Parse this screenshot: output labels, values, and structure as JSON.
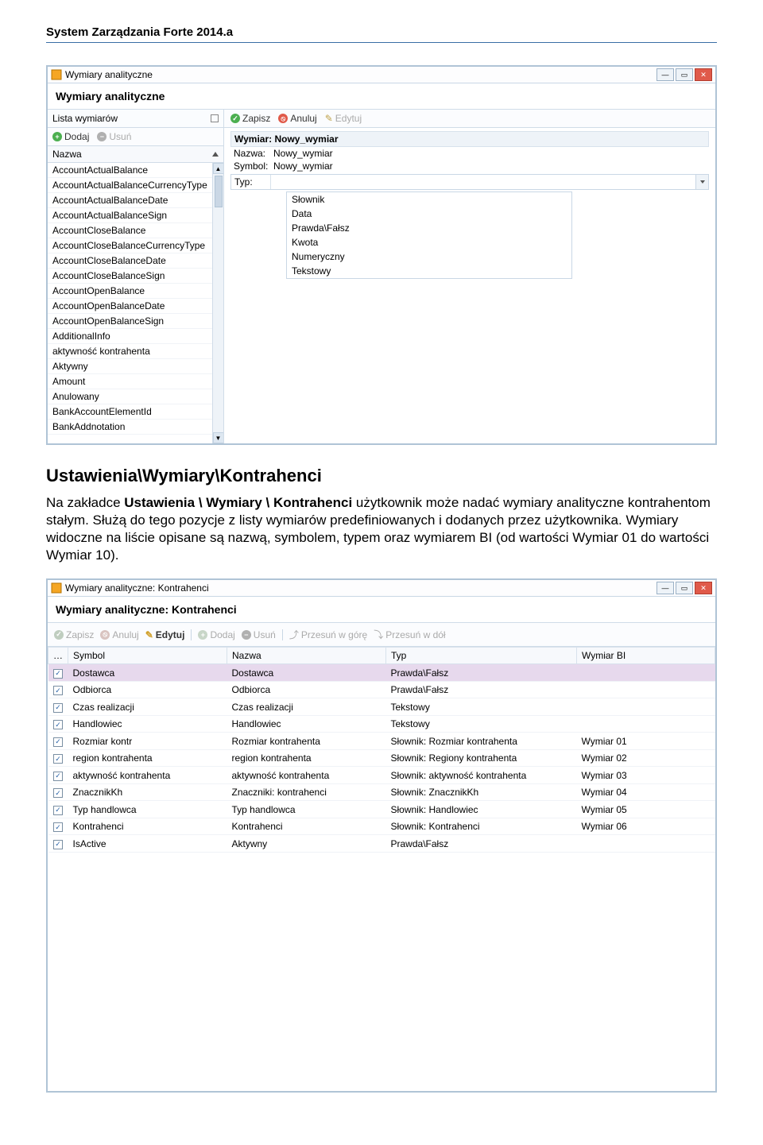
{
  "page_header": "System Zarządzania Forte 2014.a",
  "window1": {
    "title": "Wymiary analityczne",
    "big_title": "Wymiary analityczne",
    "sidebar_head": "Lista wymiarów",
    "btn_add": "Dodaj",
    "btn_del": "Usuń",
    "col_head": "Nazwa",
    "items": [
      "AccountActualBalance",
      "AccountActualBalanceCurrencyType",
      "AccountActualBalanceDate",
      "AccountActualBalanceSign",
      "AccountCloseBalance",
      "AccountCloseBalanceCurrencyType",
      "AccountCloseBalanceDate",
      "AccountCloseBalanceSign",
      "AccountOpenBalance",
      "AccountOpenBalanceDate",
      "AccountOpenBalanceSign",
      "AdditionalInfo",
      "aktywność kontrahenta",
      "Aktywny",
      "Amount",
      "Anulowany",
      "BankAccountElementId",
      "BankAddnotation"
    ],
    "btn_save": "Zapisz",
    "btn_cancel": "Anuluj",
    "btn_edit": "Edytuj",
    "form_header": "Wymiar: Nowy_wymiar",
    "form_nazwa_lbl": "Nazwa:",
    "form_nazwa_val": "Nowy_wymiar",
    "form_symbol_lbl": "Symbol:",
    "form_symbol_val": "Nowy_wymiar",
    "form_typ_lbl": "Typ:",
    "dd_items": [
      "Słownik",
      "Data",
      "Prawda\\Fałsz",
      "Kwota",
      "Numeryczny",
      "Tekstowy"
    ]
  },
  "section": {
    "title": "Ustawienia\\Wymiary\\Kontrahenci",
    "p1a": "Na zakładce ",
    "p1b": "Ustawienia \\ Wymiary \\ Kontrahenci",
    "p1c": " użytkownik może nadać wymiary analityczne kontrahentom stałym. Służą do tego pozycje z listy wymiarów predefiniowanych i dodanych przez użytkownika. Wymiary widoczne na liście opisane są nazwą, symbolem, typem oraz wymiarem BI (od wartości Wymiar 01 do wartości Wymiar 10)."
  },
  "window2": {
    "title": "Wymiary analityczne: Kontrahenci",
    "big_title": "Wymiary analityczne: Kontrahenci",
    "btn_save": "Zapisz",
    "btn_cancel": "Anuluj",
    "btn_edit": "Edytuj",
    "btn_add": "Dodaj",
    "btn_del": "Usuń",
    "btn_up": "Przesuń w górę",
    "btn_down": "Przesuń w dół",
    "cols": {
      "c0": "…",
      "c1": "Symbol",
      "c2": "Nazwa",
      "c3": "Typ",
      "c4": "Wymiar BI"
    },
    "rows": [
      {
        "chk": true,
        "sel": true,
        "symbol": "Dostawca",
        "nazwa": "Dostawca",
        "typ": "Prawda\\Fałsz",
        "bi": ""
      },
      {
        "chk": true,
        "sel": false,
        "symbol": "Odbiorca",
        "nazwa": "Odbiorca",
        "typ": "Prawda\\Fałsz",
        "bi": ""
      },
      {
        "chk": true,
        "sel": false,
        "symbol": "Czas realizacji",
        "nazwa": "Czas realizacji",
        "typ": "Tekstowy",
        "bi": ""
      },
      {
        "chk": true,
        "sel": false,
        "symbol": "Handlowiec",
        "nazwa": "Handlowiec",
        "typ": "Tekstowy",
        "bi": ""
      },
      {
        "chk": true,
        "sel": false,
        "symbol": "Rozmiar kontr",
        "nazwa": "Rozmiar kontrahenta",
        "typ": "Słownik: Rozmiar kontrahenta",
        "bi": "Wymiar 01"
      },
      {
        "chk": true,
        "sel": false,
        "symbol": "region kontrahenta",
        "nazwa": "region kontrahenta",
        "typ": "Słownik: Regiony kontrahenta",
        "bi": "Wymiar 02"
      },
      {
        "chk": true,
        "sel": false,
        "symbol": "aktywność kontrahenta",
        "nazwa": "aktywność kontrahenta",
        "typ": "Słownik: aktywność kontrahenta",
        "bi": "Wymiar 03"
      },
      {
        "chk": true,
        "sel": false,
        "symbol": "ZnacznikKh",
        "nazwa": "Znaczniki: kontrahenci",
        "typ": "Słownik: ZnacznikKh",
        "bi": "Wymiar 04"
      },
      {
        "chk": true,
        "sel": false,
        "symbol": "Typ handlowca",
        "nazwa": "Typ handlowca",
        "typ": "Słownik: Handlowiec",
        "bi": "Wymiar 05"
      },
      {
        "chk": true,
        "sel": false,
        "symbol": "Kontrahenci",
        "nazwa": "Kontrahenci",
        "typ": "Słownik: Kontrahenci",
        "bi": "Wymiar 06"
      },
      {
        "chk": true,
        "sel": false,
        "symbol": "IsActive",
        "nazwa": "Aktywny",
        "typ": "Prawda\\Fałsz",
        "bi": ""
      }
    ]
  }
}
